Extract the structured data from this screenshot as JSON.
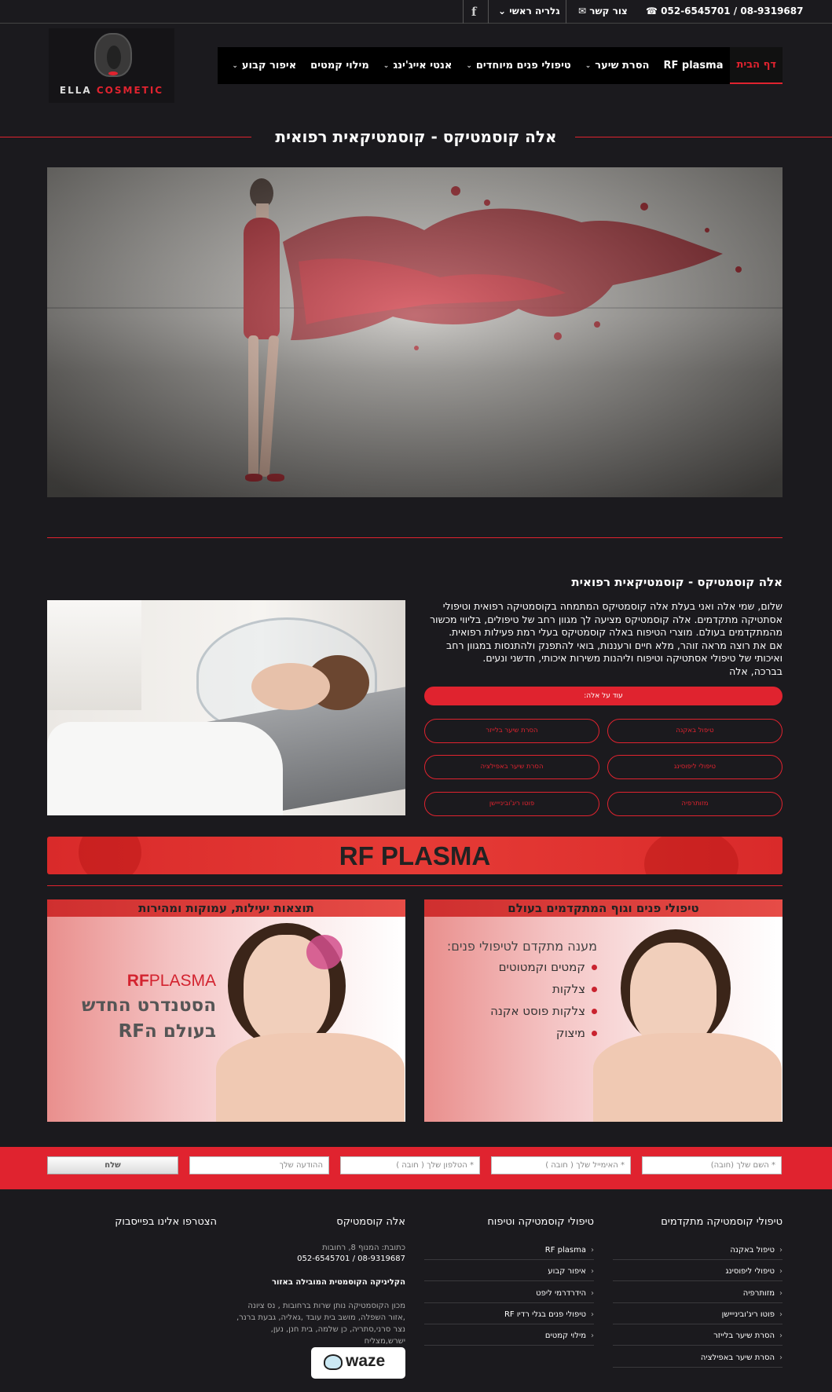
{
  "topbar": {
    "phone": "052-6545701 / 08-9319687",
    "phone_icon": "phone-icon",
    "contact_label": "צור קשר",
    "gallery_label": "גלריה ראשי",
    "facebook_icon": "f"
  },
  "logo": {
    "text_part1": "ELLA",
    "text_part2": "COSMETIC"
  },
  "nav": {
    "items": [
      {
        "label": "דף הבית",
        "active": true,
        "dropdown": false
      },
      {
        "label": "RF plasma",
        "dropdown": false
      },
      {
        "label": "הסרת שיער",
        "dropdown": true
      },
      {
        "label": "טיפולי פנים מיוחדים",
        "dropdown": true
      },
      {
        "label": "אנטי אייג'ינג",
        "dropdown": true
      },
      {
        "label": "מילוי קמטים",
        "dropdown": false
      },
      {
        "label": "איפור קבוע",
        "dropdown": true
      }
    ]
  },
  "page_title": "אלה קוסמטיקס - קוסמטיקאית רפואית",
  "intro": {
    "title": "אלה קוסמטיקס - קוסמטיקאית רפואית",
    "paragraphs": [
      "שלום, שמי אלה ואני בעלת אלה קוסמטיקס המתמחה בקוסמטיקה רפואית וטיפולי אסתטיקה מתקדמים. אלה קוסמטיקס מציעה לך מגוון רחב של טיפולים, בליווי מכשור מהמתקדמים בעולם. מוצרי הטיפוח באלה קוסמטיקס בעלי רמת פעילות רפואית.",
      "אם את רוצה מראה זוהר, מלא חיים ורעננות, בואי להתפנק ולהתנסות במגוון רחב ואיכותי של טיפולי אסתטיקה וטיפוח וליהנות משירות איכותי, חדשני ונעים.",
      "בברכה, אלה"
    ],
    "more_button": "עוד על אלה:"
  },
  "pills": [
    "טיפול באקנה",
    "הסרת שיער בלייזר",
    "טיפולי ליפוסינג",
    "הסרת שיער באפילציה",
    "מזותרפיה",
    "פוטו ריג'ובינייישן"
  ],
  "rf_banner": "RF PLASMA",
  "cards": {
    "left": {
      "header": "תוצאות יעילות, עמוקות ומהירות",
      "brand_rf": "RF",
      "brand_plasma": "PLASMA",
      "line1": "הסטנדרט החדש",
      "line2": "בעולם הRF"
    },
    "right": {
      "header": "טיפולי פנים וגוף המתקדמים בעולם",
      "subtitle": "מענה מתקדם לטיפולי פנים:",
      "items": [
        "קמטים וקמטוטים",
        "צלקות",
        "צלקות פוסט אקנה",
        "מיצוק"
      ]
    }
  },
  "form": {
    "name_placeholder": "* השם שלך (חובה)",
    "email_placeholder": "* האימייל שלך ( חובה )",
    "phone_placeholder": "* הטלפון שלך ( חובה )",
    "message_placeholder": "ההודעה שלך",
    "send_label": "שלח"
  },
  "footer": {
    "col1": {
      "title": "טיפולי קוסמטיקה מתקדמים",
      "links": [
        "טיפול באקנה",
        "טיפולי ליפוסינג",
        "מזותרפיה",
        "פוטו ריג'ובינייישן",
        "הסרת שיער בלייזר",
        "הסרת שיער באפילציה"
      ]
    },
    "col2": {
      "title": "טיפולי קוסמטיקה וטיפוח",
      "links": [
        "RF plasma",
        "איפור קבוע",
        "הידרדרמי ליפט",
        "טיפולי פנים בגלי רדיו RF",
        "מילוי קמטים"
      ]
    },
    "col3": {
      "title": "אלה קוסמטיקס",
      "address": "כתובת: המנוף 8, רחובות",
      "phones": "052-6545701 / 08-9319687",
      "headline": "הקליניקה הקוסמטית המובילה באזור",
      "description": "מכון הקוסמטיקה נותן שרות ברחובות , נס ציונה ,אזור השפלה, מושב בית עובד ,גאליה, גבעת ברנר, נצר סרני,סתריה, כן שלמה, בית חנן, נען, ישרש,מצליח",
      "waze": "waze"
    },
    "col4": {
      "title": "הצטרפו אלינו בפייסבוק"
    }
  }
}
